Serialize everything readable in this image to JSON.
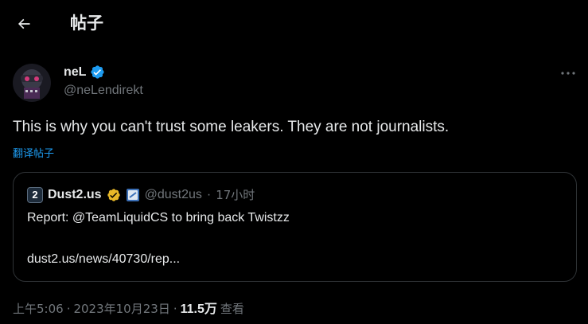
{
  "header": {
    "title": "帖子",
    "back_icon": "arrow-left-icon"
  },
  "tweet": {
    "author": {
      "name": "neL",
      "handle": "@neLendirekt",
      "verified": true,
      "verified_color": "#1d9bf0"
    },
    "text": "This is why you can't trust some leakers. They are not journalists.",
    "translate_label": "翻译帖子",
    "more_icon": "more-horizontal-icon",
    "quote": {
      "avatar_text": "2",
      "name": "Dust2.us",
      "gold_badge_color": "#e8b828",
      "affiliate_badge_color": "#3b6fb6",
      "handle": "@dust2us",
      "separator": "·",
      "time": "17小时",
      "text": "Report: @TeamLiquidCS to bring back Twistzz",
      "link": "dust2.us/news/40730/rep..."
    },
    "meta": {
      "time": "上午5:06",
      "date": "2023年10月23日",
      "separator": "·",
      "views_count": "11.5万",
      "views_label": "查看"
    }
  },
  "colors": {
    "background": "#000000",
    "accent": "#1d9bf0",
    "text": "#e7e9ea",
    "muted": "#71767b",
    "border": "#2f3336"
  }
}
